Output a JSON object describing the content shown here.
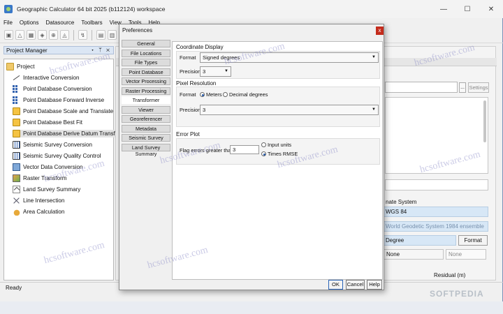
{
  "window": {
    "title": "Geographic Calculator 64 bit 2025 (b112124) workspace",
    "controls": [
      "—",
      "☐",
      "✕"
    ]
  },
  "menubar": [
    "File",
    "Options",
    "Datasource",
    "Toolbars",
    "View",
    "Tools",
    "Help"
  ],
  "project_manager": {
    "header": "Project Manager",
    "header_controls": "▾ ᛘ ✕",
    "root": "Project",
    "items": [
      {
        "label": "Interactive Conversion",
        "icon": "line-icon"
      },
      {
        "label": "Point Database Conversion",
        "icon": "grid-icon"
      },
      {
        "label": "Point Database Forward Inverse",
        "icon": "grid-icon"
      },
      {
        "label": "Point Database Scale and Translate",
        "icon": "yellow-icon"
      },
      {
        "label": "Point Database Best Fit",
        "icon": "yellow-icon"
      },
      {
        "label": "Point Database Derive Datum Transform",
        "icon": "yellow-icon"
      },
      {
        "label": "Seismic Survey Conversion",
        "icon": "seismic-icon"
      },
      {
        "label": "Seismic Survey Quality Control",
        "icon": "seismic-icon"
      },
      {
        "label": "Vector Data Conversion",
        "icon": "vector-icon"
      },
      {
        "label": "Raster Transform",
        "icon": "raster-icon"
      },
      {
        "label": "Land Survey Summary",
        "icon": "land-icon"
      },
      {
        "label": "Line Intersection",
        "icon": "x-icon"
      },
      {
        "label": "Area Calculation",
        "icon": "area-icon"
      }
    ]
  },
  "right_pane": {
    "small_btn": "...",
    "settings_btn": "Settings",
    "system_label": "nate System",
    "wgs": "WGS 84",
    "wgs_desc": "World Geodetic System 1984 ensemble",
    "degree": "Degree",
    "format_btn": "Format",
    "none1": "None",
    "none2": "None",
    "residual": "Residual (m)"
  },
  "dialog": {
    "title": "Preferences",
    "close": "x",
    "nav": [
      "General",
      "File Locations",
      "File Types",
      "Point Database",
      "Vector Processing",
      "Raster Processing",
      "Transformer",
      "Viewer",
      "Georeferencer",
      "Metadata",
      "Seismic Survey",
      "Land Survey Summary"
    ],
    "active_nav": "Transformer",
    "coord_display": {
      "title": "Coordinate Display",
      "format_label": "Format",
      "format_value": "Signed degrees",
      "precision_label": "Precision",
      "precision_value": "3"
    },
    "pixel_resolution": {
      "title": "Pixel Resolution",
      "format_label": "Format",
      "opt_meters": "Meters",
      "opt_decimal": "Decimal degrees",
      "selected": "Meters",
      "precision_label": "Precision",
      "precision_value": "3"
    },
    "error_plot": {
      "title": "Error Plot",
      "flag_label": "Flag errors greater than",
      "flag_value": "3",
      "opt_input": "Input units",
      "opt_rmse": "Times RMSE",
      "selected": "Times RMSE"
    },
    "buttons": {
      "ok": "OK",
      "cancel": "Cancel",
      "help": "Help"
    }
  },
  "status": "Ready",
  "watermarks": [
    "hcsoftware.com",
    "hcsoftware.com",
    "hcsoftware.com",
    "hcsoftware.com",
    "hcsoftware.com",
    "hcsoftware.com",
    "hcsoftware.com",
    "hcsoftware.com",
    "hcsoftware.com"
  ],
  "softpedia": "SOFTPEDIA"
}
